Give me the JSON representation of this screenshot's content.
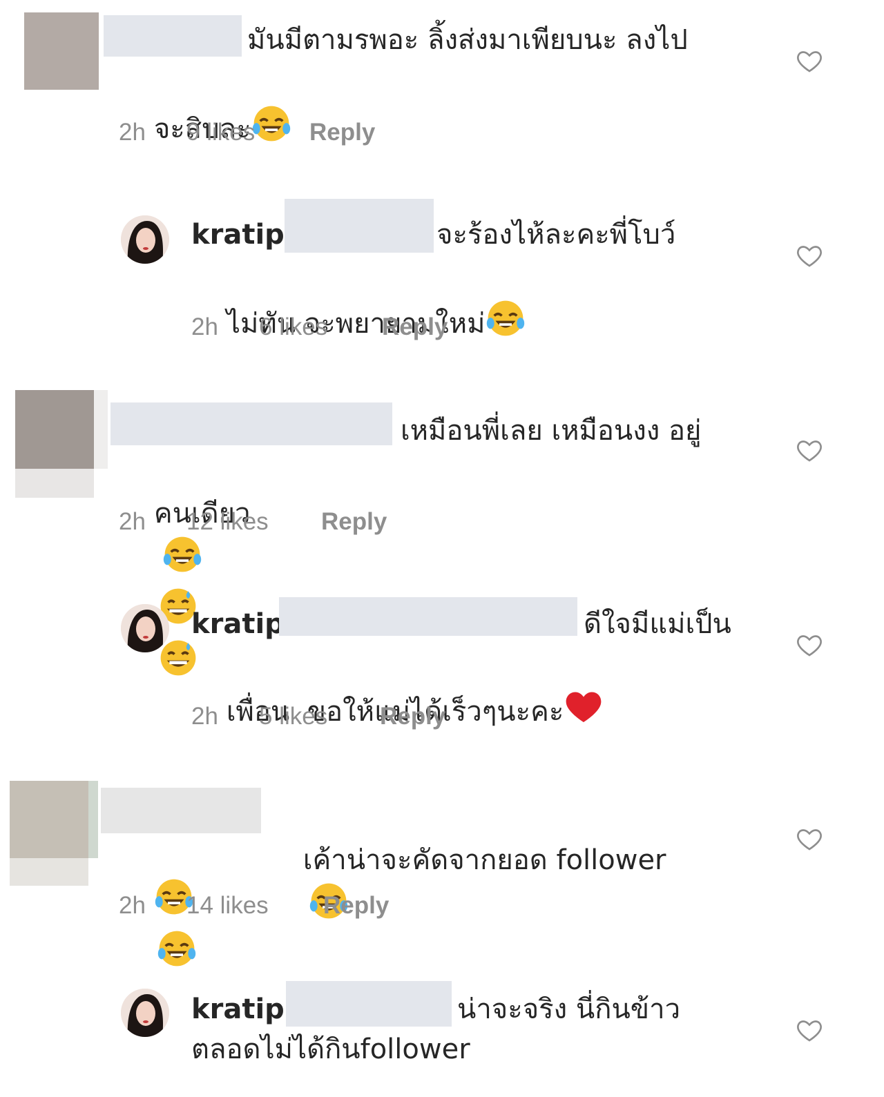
{
  "comments": [
    {
      "username": "",
      "text_line1": "มันมีตามรพอะ ลิ้งส่งมาเพียบนะ ลงไป",
      "text_line2": "จะสิบละ",
      "emojis": [
        "face-with-tears-of-joy"
      ],
      "time": "2h",
      "likes": "9 likes",
      "reply": "Reply"
    },
    {
      "username": "kratip",
      "text_line1": "จะร้องไห้ละคะพี่โบว์",
      "text_line2": "ไม่ทัน จะพยายามใหม่",
      "emojis": [
        "face-with-tears-of-joy"
      ],
      "time": "2h",
      "likes": "6 likes",
      "reply": "Reply"
    },
    {
      "username": "",
      "text_line1": "เหมือนพี่เลย เหมือนงง อยู่",
      "text_line2": "คนเดียว",
      "emojis": [
        "face-with-tears-of-joy",
        "grinning-face-with-sweat",
        "grinning-face-with-sweat"
      ],
      "time": "2h",
      "likes": "12 likes",
      "reply": "Reply"
    },
    {
      "username": "kratip",
      "text_line1": "ดีใจมีแม่เป็น",
      "text_line2": "เพื่อน  ขอให้แม่ได้เร็วๆนะคะ",
      "emojis": [
        "red-heart"
      ],
      "time": "2h",
      "likes": "5 likes",
      "reply": "Reply"
    },
    {
      "username": "",
      "text_line1": "เค้าน่าจะคัดจากยอด follower",
      "text_line2": "",
      "emojis": [
        "face-with-tears-of-joy",
        "face-with-tears-of-joy",
        "face-with-tears-of-joy"
      ],
      "time": "2h",
      "likes": "14 likes",
      "reply": "Reply"
    },
    {
      "username": "kratip",
      "text_line1": "น่าจะจริง นี่กินข้าว",
      "text_line2": "ตลอดไม่ได้กินfollower",
      "emojis": [],
      "time": "",
      "likes": "",
      "reply": ""
    }
  ],
  "colors": {
    "text": "#262626",
    "meta": "#8e8e8e",
    "redaction": "#e3e6ec",
    "heart_outline": "#8e8e8e"
  }
}
